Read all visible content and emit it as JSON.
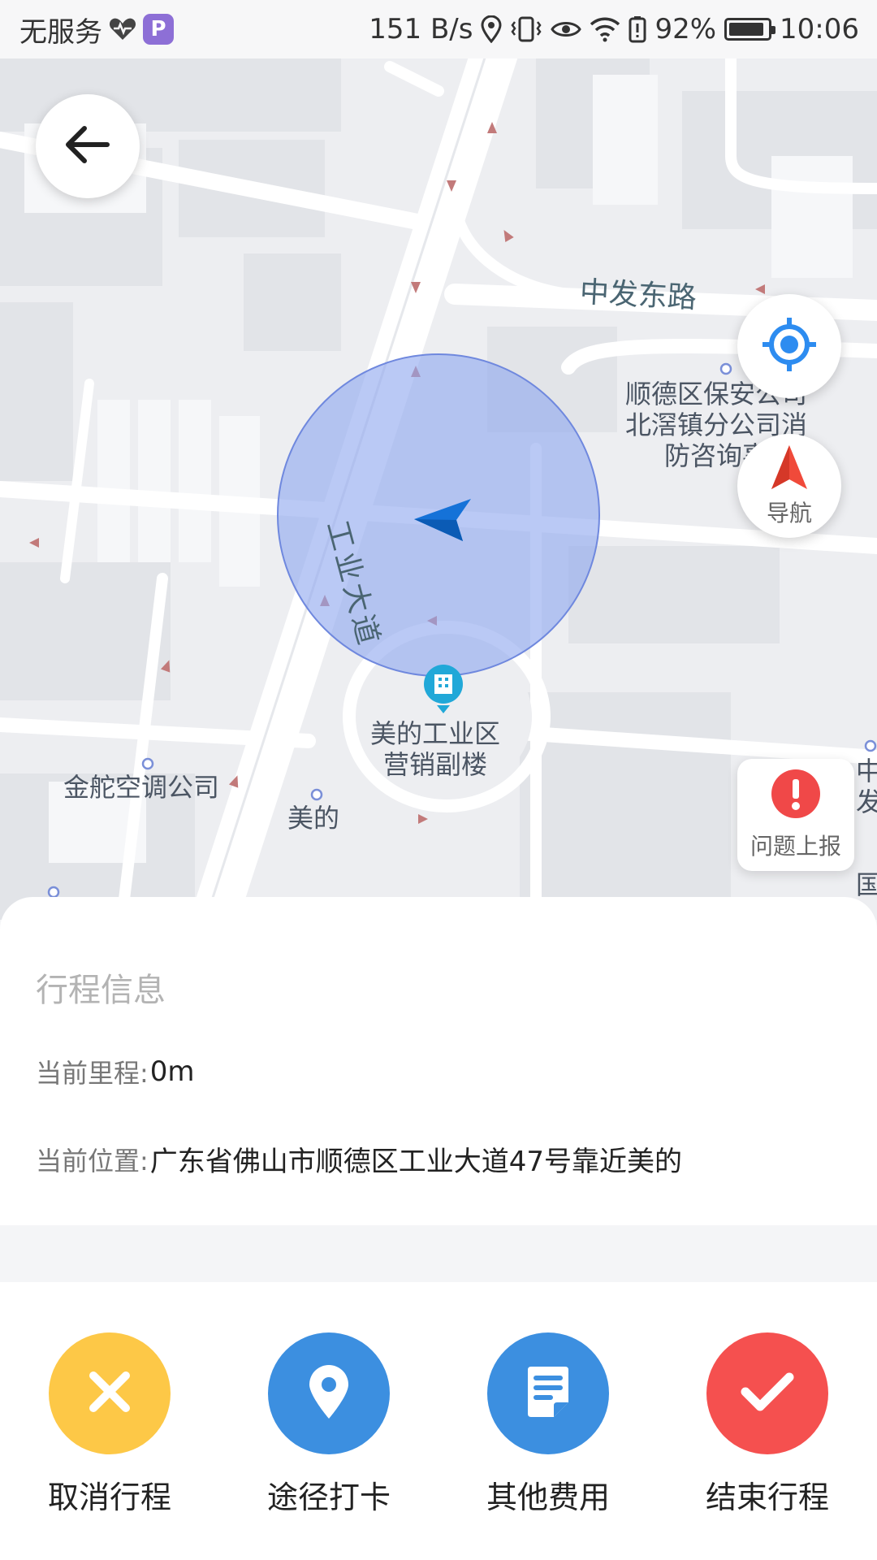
{
  "status_bar": {
    "carrier": "无服务",
    "app_badge": "P",
    "net_speed": "151 B/s",
    "battery_pct": "92%",
    "battery_level": 0.92,
    "time": "10:06"
  },
  "map": {
    "road_label": "中发东路",
    "avenue_label": "工业大道",
    "poi_labels": {
      "security_company": "顺德区保安公司\n北滘镇分公司消\n防咨询事",
      "midea_building": "美的工业区\n营销副楼",
      "ac_company": "金舵空调公司",
      "midea": "美的",
      "edge_right_top": "中\n发",
      "edge_right_bottom": "国"
    },
    "nav_button_label": "导航",
    "report_button_label": "问题上报"
  },
  "trip_info": {
    "title": "行程信息",
    "mileage_label": "当前里程:",
    "mileage_value": "0m",
    "location_label": "当前位置:",
    "location_value": "广东省佛山市顺德区工业大道47号靠近美的"
  },
  "actions": [
    {
      "label": "取消行程",
      "icon": "close-icon",
      "color": "#fdc847"
    },
    {
      "label": "途径打卡",
      "icon": "location-pin-icon",
      "color": "#3c8fe0"
    },
    {
      "label": "其他费用",
      "icon": "document-icon",
      "color": "#3c8fe0"
    },
    {
      "label": "结束行程",
      "icon": "check-icon",
      "color": "#f5504f"
    }
  ],
  "colors": {
    "accuracy_circle": "#8fa8ef",
    "locate_blue": "#2d8cf0",
    "nav_red": "#f04a3a"
  }
}
